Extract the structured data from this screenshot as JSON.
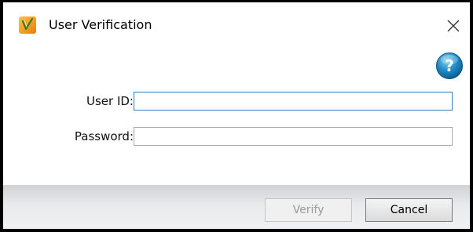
{
  "window": {
    "title": "User Verification",
    "app_icon": "verification-check-icon",
    "close_icon": "close-icon"
  },
  "help": {
    "icon": "help-icon",
    "glyph": "?"
  },
  "form": {
    "user_id": {
      "label": "User ID:",
      "value": "",
      "placeholder": ""
    },
    "password": {
      "label": "Password:",
      "value": "",
      "placeholder": ""
    }
  },
  "buttons": {
    "verify": {
      "label": "Verify",
      "enabled": false
    },
    "cancel": {
      "label": "Cancel",
      "enabled": true
    }
  },
  "colors": {
    "focus_border": "#2b7fc6",
    "help_blue": "#1c7fb8",
    "app_icon_orange": "#f39a1c"
  }
}
